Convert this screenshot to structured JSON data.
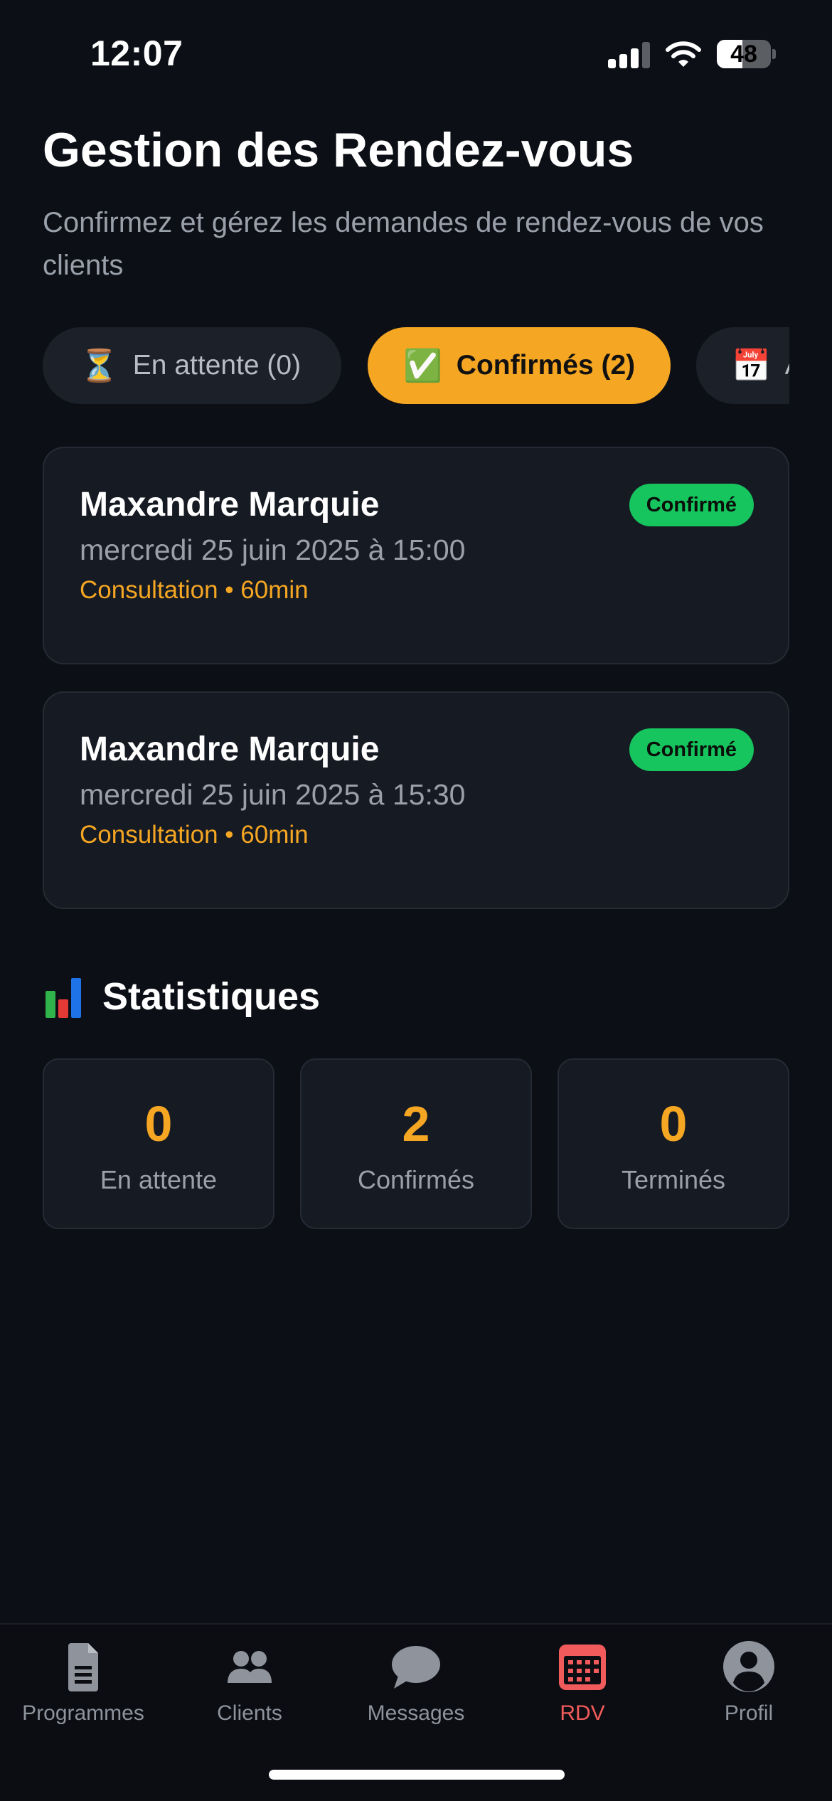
{
  "status_bar": {
    "time": "12:07",
    "battery_level": "48",
    "battery_fraction": 0.48,
    "icons": [
      "signal-icon",
      "wifi-icon",
      "battery-icon"
    ]
  },
  "header": {
    "title": "Gestion des Rendez-vous",
    "subtitle": "Confirmez et gérez les demandes de rendez-vous de vos clients"
  },
  "tabs": [
    {
      "emoji": "⏳",
      "label": "En attente (0)",
      "active": false
    },
    {
      "emoji": "✅",
      "label": "Confirmés (2)",
      "active": true
    },
    {
      "emoji": "📅",
      "label": "A",
      "active": false
    }
  ],
  "appointments": [
    {
      "name": "Maxandre Marquie",
      "datetime": "mercredi 25 juin 2025 à 15:00",
      "details": "Consultation • 60min",
      "status": "Confirmé"
    },
    {
      "name": "Maxandre Marquie",
      "datetime": "mercredi 25 juin 2025 à 15:30",
      "details": "Consultation • 60min",
      "status": "Confirmé"
    }
  ],
  "stats": {
    "title": "Statistiques",
    "items": [
      {
        "value": "0",
        "label": "En attente"
      },
      {
        "value": "2",
        "label": "Confirmés"
      },
      {
        "value": "0",
        "label": "Terminés"
      }
    ]
  },
  "nav": [
    {
      "label": "Programmes",
      "icon": "document-icon",
      "active": false
    },
    {
      "label": "Clients",
      "icon": "users-icon",
      "active": false
    },
    {
      "label": "Messages",
      "icon": "chat-bubble-icon",
      "active": false
    },
    {
      "label": "RDV",
      "icon": "calendar-icon",
      "active": true
    },
    {
      "label": "Profil",
      "icon": "user-circle-icon",
      "active": false
    }
  ],
  "colors": {
    "background": "#0c0f16",
    "card": "#161a22",
    "accent": "#f5a623",
    "confirmed_badge": "#16c55e",
    "nav_active": "#f15b5b",
    "muted_text": "#9aa0aa"
  }
}
